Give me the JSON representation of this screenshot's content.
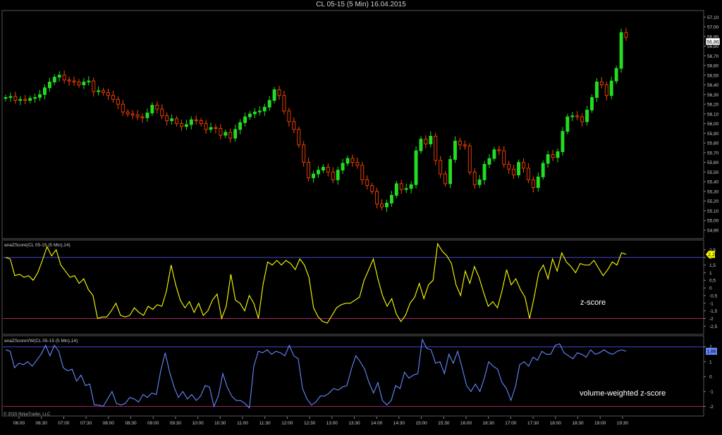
{
  "title": "CL 05-15 (5 Min)  16.04.2015",
  "copyright": "© 2015 NinjaTrader, LLC",
  "colors": {
    "bull": "#22dd22",
    "bear": "#ff4400",
    "doji": "#ffffff",
    "zscore": "#ffff00",
    "zscore_vw": "#6688ff",
    "upper_line": "#4444cc",
    "lower_line": "#aa2266",
    "grid_border": "#555555"
  },
  "chart_data": [
    {
      "id": "price",
      "type": "candlestick",
      "y_ticks": [
        "54,90",
        "55,00",
        "55,10",
        "55,20",
        "55,30",
        "55,40",
        "55,50",
        "55,60",
        "55,70",
        "55,80",
        "55,90",
        "56,00",
        "56,10",
        "56,20",
        "56,30",
        "56,40",
        "56,50",
        "56,60",
        "56,70",
        "56,80",
        "56,90",
        "57,00",
        "57,10"
      ],
      "ylim": [
        54.82,
        57.16
      ],
      "last_price_label": "56,86",
      "x_ticks": [
        "06:00",
        "06:30",
        "07:00",
        "07:30",
        "08:00",
        "08:30",
        "09:00",
        "09:30",
        "10:00",
        "10:30",
        "11:00",
        "11:30",
        "12:00",
        "12:30",
        "13:00",
        "13:30",
        "14:00",
        "14:30",
        "15:00",
        "15:30",
        "16:00",
        "16:30",
        "17:00",
        "17:30",
        "18:00",
        "18:30",
        "19:00",
        "19:30"
      ],
      "close": [
        56.27,
        56.28,
        56.24,
        56.25,
        56.24,
        56.26,
        56.27,
        56.3,
        56.37,
        56.43,
        56.48,
        56.5,
        56.45,
        56.44,
        56.43,
        56.4,
        56.43,
        56.44,
        56.33,
        56.34,
        56.32,
        56.29,
        56.25,
        56.2,
        56.12,
        56.1,
        56.09,
        56.07,
        56.06,
        56.11,
        56.19,
        56.15,
        56.08,
        56.03,
        56.05,
        56.0,
        55.97,
        55.99,
        56.04,
        56.03,
        56.0,
        55.94,
        55.96,
        55.95,
        55.88,
        55.91,
        55.85,
        55.94,
        56.01,
        56.07,
        56.1,
        56.12,
        56.13,
        56.17,
        56.24,
        56.35,
        56.29,
        56.13,
        56.02,
        55.94,
        55.78,
        55.6,
        55.44,
        55.48,
        55.52,
        55.55,
        55.5,
        55.42,
        55.52,
        55.59,
        55.64,
        55.6,
        55.57,
        55.42,
        55.36,
        55.3,
        55.17,
        55.14,
        55.18,
        55.26,
        55.38,
        55.32,
        55.33,
        55.37,
        55.72,
        55.84,
        55.79,
        55.87,
        55.62,
        55.48,
        55.38,
        55.63,
        55.82,
        55.78,
        55.77,
        55.5,
        55.37,
        55.42,
        55.58,
        55.64,
        55.73,
        55.72,
        55.58,
        55.53,
        55.47,
        55.6,
        55.54,
        55.42,
        55.34,
        55.45,
        55.59,
        55.68,
        55.65,
        55.71,
        55.92,
        56.07,
        56.08,
        56.07,
        56.02,
        56.14,
        56.27,
        56.43,
        56.4,
        56.29,
        56.44,
        56.57,
        56.94,
        56.89
      ],
      "ohlc_note": "open = previous close; wicks drawn +/- small range"
    },
    {
      "id": "zscore",
      "type": "line",
      "label": "anaZScore(CL 05-15 (5 Min),14)",
      "y_ticks": [
        "2,5",
        "2",
        "1,5",
        "1",
        "0,5",
        "0",
        "-0,5",
        "-1",
        "-1,5",
        "-2",
        "-2,5"
      ],
      "ylim": [
        -2.9,
        3.0
      ],
      "upper": 2.0,
      "lower": -2.0,
      "last_value_label": "2,2",
      "annotation": "z-score",
      "values": [
        2.0,
        1.9,
        0.8,
        0.9,
        0.7,
        0.8,
        0.5,
        1.0,
        1.8,
        2.7,
        2.1,
        2.5,
        1.5,
        1.1,
        0.7,
        0.8,
        0.3,
        0.6,
        -0.1,
        -0.5,
        -2.0,
        -1.9,
        -1.9,
        -1.5,
        -1.0,
        -1.8,
        -1.9,
        -1.8,
        -1.3,
        -1.6,
        -1.8,
        -1.2,
        -1.4,
        -1.1,
        -1.2,
        -0.2,
        1.5,
        0.2,
        -0.8,
        -1.3,
        -0.9,
        -1.6,
        -1.0,
        -1.8,
        -1.5,
        -0.8,
        -0.4,
        -2.0,
        -1.2,
        0.9,
        -0.8,
        -1.0,
        -1.5,
        -0.5,
        -1.0,
        -2.0,
        0.2,
        1.7,
        1.5,
        1.8,
        1.5,
        1.8,
        1.6,
        1.2,
        1.9,
        1.5,
        0.7,
        -1.3,
        -1.9,
        -2.2,
        -2.3,
        -1.8,
        -1.3,
        -1.1,
        -1.0,
        -1.0,
        -0.8,
        -0.6,
        0.5,
        1.2,
        1.9,
        0.6,
        -0.5,
        -1.2,
        -0.7,
        -1.7,
        -2.2,
        -1.8,
        -1.0,
        -0.6,
        0.3,
        -0.7,
        0.2,
        0.5,
        2.9,
        2.4,
        2.1,
        1.6,
        0.2,
        -0.5,
        1.1,
        0.3,
        1.4,
        0.7,
        -0.3,
        -1.2,
        -0.9,
        -1.3,
        -0.2,
        1.2,
        0.2,
        0.6,
        -0.1,
        -0.6,
        -2.0,
        -0.6,
        1.0,
        1.5,
        0.6,
        1.9,
        1.1,
        2.3,
        1.7,
        1.4,
        1.0,
        1.6,
        1.5,
        1.5,
        1.8,
        1.3,
        0.8,
        1.2,
        1.7,
        1.5,
        2.3,
        2.2
      ]
    },
    {
      "id": "zscore_vw",
      "type": "line",
      "label": "anaZScoreVW(CL 05-15 (5 Min),14)",
      "y_ticks": [
        "2",
        "1",
        "0",
        "-1",
        "-2"
      ],
      "ylim": [
        -2.5,
        2.6
      ],
      "upper": 2.0,
      "lower": -2.0,
      "last_value_label": "1,66",
      "annotation": "volume-weighted z-score",
      "values": [
        1.8,
        1.7,
        0.6,
        0.9,
        0.8,
        1.0,
        0.7,
        1.1,
        1.5,
        2.1,
        1.4,
        2.1,
        1.7,
        0.6,
        0.4,
        0.5,
        -0.3,
        0.1,
        -0.6,
        -0.5,
        -1.9,
        -1.9,
        -2.0,
        -1.5,
        -1.0,
        -1.8,
        -1.9,
        -1.8,
        -1.4,
        -1.5,
        -1.7,
        -1.2,
        -1.4,
        -1.1,
        -1.2,
        0.4,
        1.6,
        0.3,
        -0.7,
        -1.4,
        -1.0,
        -1.5,
        -1.2,
        -1.6,
        -1.3,
        -0.6,
        -0.7,
        -2.0,
        -1.3,
        0.2,
        -0.7,
        -1.3,
        -1.6,
        -1.6,
        -1.8,
        -2.1,
        0.7,
        1.7,
        1.6,
        1.8,
        1.5,
        1.7,
        1.6,
        1.4,
        2.1,
        1.4,
        1.2,
        -0.8,
        -1.5,
        -1.9,
        -1.7,
        -1.3,
        -1.3,
        -1.1,
        -0.8,
        -0.9,
        -0.7,
        -0.6,
        0.5,
        1.4,
        1.0,
        0.5,
        -0.4,
        -1.1,
        -0.4,
        -1.6,
        -1.9,
        -1.6,
        -0.6,
        -0.8,
        0.3,
        -0.1,
        0.1,
        0.2,
        2.5,
        1.9,
        1.8,
        0.9,
        1.0,
        0.2,
        1.5,
        0.9,
        1.7,
        0.6,
        -0.6,
        -1.0,
        -0.5,
        -1.0,
        -0.1,
        1.0,
        0.7,
        0.5,
        -0.4,
        -0.8,
        -1.6,
        -0.7,
        0.8,
        1.0,
        0.7,
        1.3,
        1.1,
        1.7,
        1.5,
        1.5,
        2.1,
        2.2,
        1.6,
        1.4,
        1.2,
        1.6,
        1.5,
        1.3,
        1.8,
        1.5,
        1.6,
        1.8,
        1.6,
        1.5,
        1.7,
        1.8,
        1.7
      ]
    }
  ]
}
